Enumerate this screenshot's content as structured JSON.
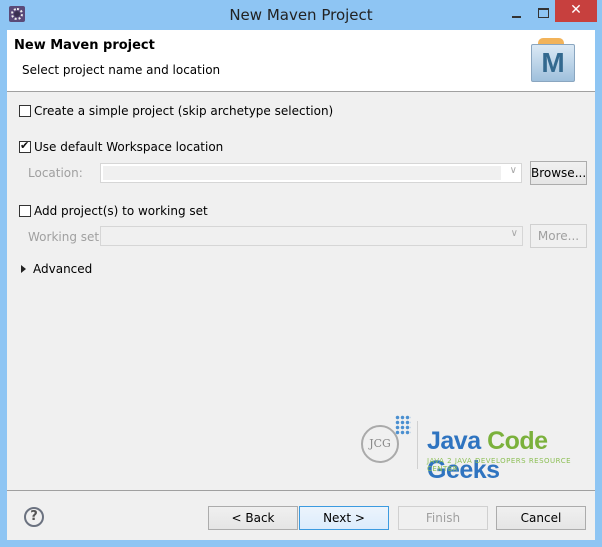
{
  "window": {
    "title": "New Maven Project",
    "close_glyph": "✕",
    "app_icon": "eclipse-gear-icon"
  },
  "header": {
    "title": "New Maven project",
    "description": "Select project name and location",
    "icon": "maven-folder-icon",
    "icon_letter": "M"
  },
  "form": {
    "simple_project": {
      "label": "Create a simple project (skip archetype selection)",
      "checked": false
    },
    "default_workspace": {
      "label": "Use default Workspace location",
      "checked": true
    },
    "location": {
      "label": "Location:",
      "value": "",
      "enabled": false
    },
    "browse_button": "Browse...",
    "working_set_check": {
      "label": "Add project(s) to working set",
      "checked": false
    },
    "working_set": {
      "label": "Working set:",
      "value": "",
      "enabled": false
    },
    "more_button": "More...",
    "advanced": {
      "label": "Advanced",
      "expanded": false
    },
    "combo_arrow": "∨"
  },
  "watermark": {
    "logo_initials": "JCG",
    "word1": "Java",
    "word2": "Code",
    "word3": "Geeks",
    "subtitle": "JAVA 2 JAVA DEVELOPERS RESOURCE CENTER"
  },
  "footer": {
    "help_glyph": "?",
    "back": "< Back",
    "next": "Next >",
    "finish": "Finish",
    "cancel": "Cancel"
  }
}
